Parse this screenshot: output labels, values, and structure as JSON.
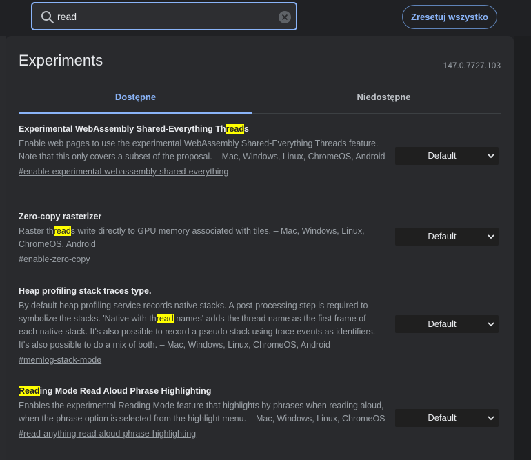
{
  "search": {
    "value": "read"
  },
  "reset_label": "Zresetuj wszystko",
  "title": "Experiments",
  "version": "147.0.7727.103",
  "tabs": [
    "Dostępne",
    "Niedostępne"
  ],
  "highlight": "read",
  "experiments": [
    {
      "name_parts": [
        "Experimental WebAssembly Shared-Everything Th",
        "read",
        "s"
      ],
      "desc_parts": [
        "Enable web pages to use the experimental WebAssembly Shared-Everything Threads feature. Note that this only covers a subset of the proposal. – Mac, Windows, Linux, ChromeOS, Android"
      ],
      "link": "#enable-experimental-webassembly-shared-everything",
      "select": "Default"
    },
    {
      "name_parts": [
        "Zero-copy rasterizer"
      ],
      "desc_parts": [
        "Raster th",
        "read",
        "s write directly to GPU memory associated with tiles. – Mac, Windows, Linux, ChromeOS, Android"
      ],
      "link": "#enable-zero-copy",
      "select": "Default"
    },
    {
      "name_parts": [
        "Heap profiling stack traces type."
      ],
      "desc_parts": [
        "By default heap profiling service records native stacks. A post-processing step is required to symbolize the stacks. 'Native with th",
        "read",
        " names' adds the thread name as the first frame of each native stack. It's also possible to record a pseudo stack using trace events as identifiers. It's also possible to do a mix of both. – Mac, Windows, Linux, ChromeOS, Android"
      ],
      "link": "#memlog-stack-mode",
      "select": "Default"
    },
    {
      "name_parts": [
        "",
        "Read",
        "ing Mode Read Aloud Phrase Highlighting"
      ],
      "desc_parts": [
        "Enables the experimental Reading Mode feature that highlights by phrases when reading aloud, when the phrase option is selected from the highlight menu. – Mac, Windows, Linux, ChromeOS"
      ],
      "link": "#read-anything-read-aloud-phrase-highlighting",
      "select": "Default"
    }
  ],
  "colors": {
    "accent": "#8ab4f8",
    "highlight": "#ffff00",
    "background": "#202124",
    "panel": "#292a2d"
  },
  "icons": {
    "search": "search-icon",
    "clear": "clear-icon",
    "dropdown": "chevron-down-icon"
  }
}
